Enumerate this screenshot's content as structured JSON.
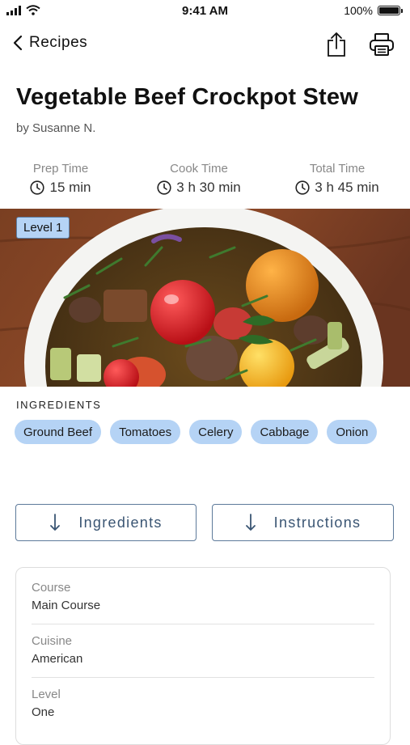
{
  "status_bar": {
    "time": "9:41 AM",
    "battery": "100%",
    "battery_level": 1.0
  },
  "nav": {
    "back_label": "Recipes"
  },
  "recipe": {
    "title": "Vegetable Beef Crockpot Stew",
    "author": "by Susanne N.",
    "times": [
      {
        "label": "Prep Time",
        "value": "15 min"
      },
      {
        "label": "Cook Time",
        "value": "3 h 30 min"
      },
      {
        "label": "Total Time",
        "value": "3 h 45 min"
      }
    ],
    "level_badge": "Level 1"
  },
  "ingredients_section": {
    "heading": "INGREDIENTS",
    "chips": [
      "Ground Beef",
      "Tomatoes",
      "Celery",
      "Cabbage",
      "Onion"
    ]
  },
  "jump_buttons": {
    "ingredients": "Ingredients",
    "instructions": "Instructions"
  },
  "details": [
    {
      "key": "Course",
      "value": "Main Course"
    },
    {
      "key": "Cuisine",
      "value": "American"
    },
    {
      "key": "Level",
      "value": "One"
    }
  ],
  "colors": {
    "chip_bg": "#b5d3f5",
    "button_border": "#5d7a9a",
    "button_text": "#3a5573"
  }
}
